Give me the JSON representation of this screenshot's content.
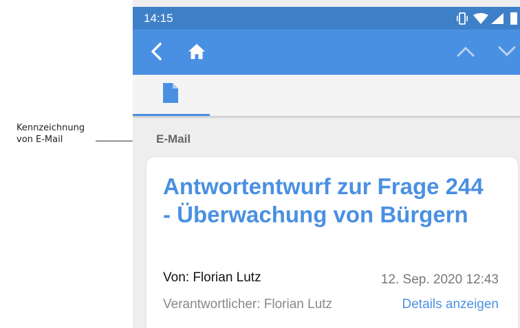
{
  "annotation": {
    "label_line1": "Kennzeichnung",
    "label_line2": "von E-Mail"
  },
  "statusbar": {
    "time": "14:15",
    "icons": [
      "vibrate-icon",
      "wifi-icon",
      "signal-icon",
      "battery-icon"
    ]
  },
  "appbar": {
    "icons": [
      "back-arrow-icon",
      "home-icon",
      "chevron-up-icon",
      "chevron-down-icon"
    ]
  },
  "tabs": [
    {
      "icon": "document-icon",
      "active": true
    }
  ],
  "section": {
    "label": "E-Mail"
  },
  "email": {
    "subject": "Antwortentwurf zur Frage 244 - Überwachung von Bürgern",
    "from": "Von: Florian Lutz",
    "date": "12. Sep. 2020 12:43",
    "responsible": "Verantwortlicher: Florian Lutz",
    "details_link": "Details anzeigen"
  },
  "colors": {
    "statusbar": "#3e80c8",
    "appbar": "#4a90e2",
    "accent": "#4a90e2",
    "background": "#eeeeee"
  }
}
